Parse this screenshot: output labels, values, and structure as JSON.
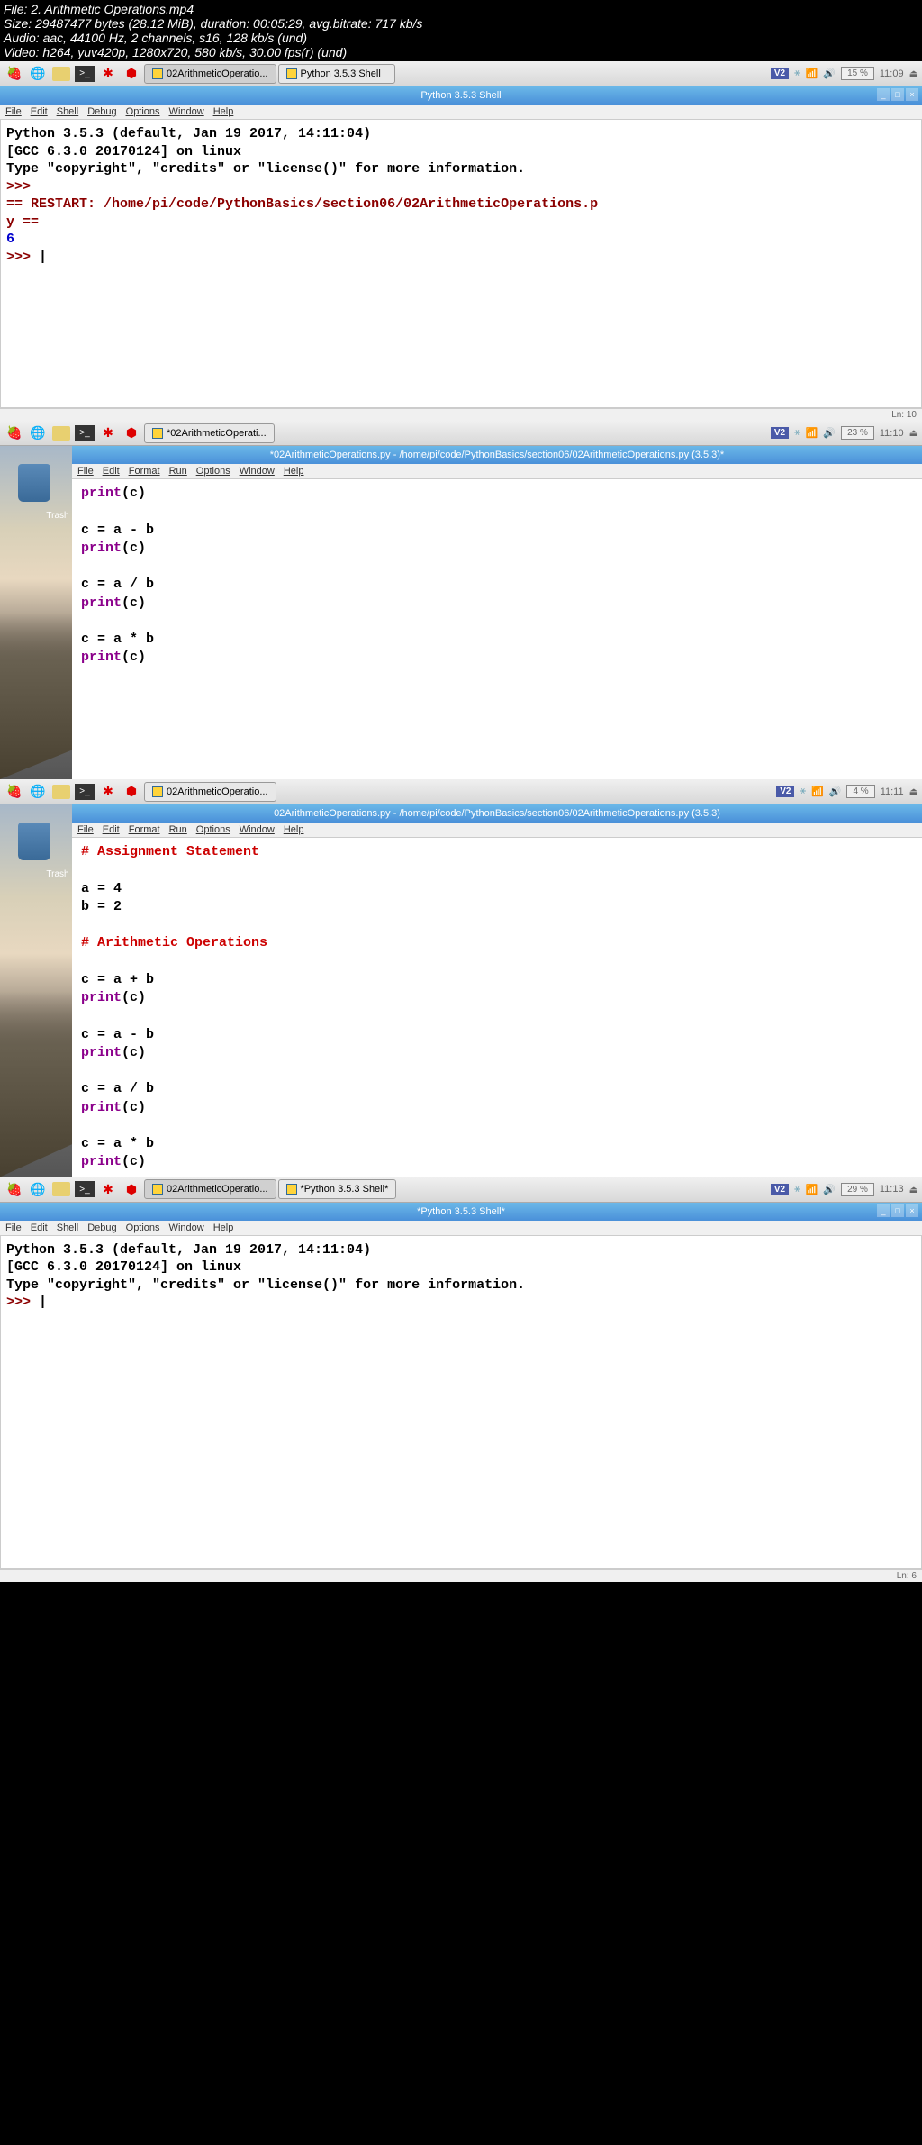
{
  "header": {
    "file": "File: 2. Arithmetic Operations.mp4",
    "size": "Size: 29487477 bytes (28.12 MiB), duration: 00:05:29, avg.bitrate: 717 kb/s",
    "audio": "Audio: aac, 44100 Hz, 2 channels, s16, 128 kb/s (und)",
    "video": "Video: h264, yuv420p, 1280x720, 580 kb/s, 30.00 fps(r) (und)"
  },
  "s1": {
    "taskbar": {
      "entry1": "02ArithmeticOperatio...",
      "entry2": "Python 3.5.3 Shell",
      "battery": "15 %",
      "time": "11:09"
    },
    "title": "Python 3.5.3 Shell",
    "menu": [
      "File",
      "Edit",
      "Shell",
      "Debug",
      "Options",
      "Window",
      "Help"
    ],
    "shell": {
      "line1": "Python 3.5.3 (default, Jan 19 2017, 14:11:04)",
      "line2": "[GCC 6.3.0 20170124] on linux",
      "line3": "Type \"copyright\", \"credits\" or \"license()\" for more information.",
      "prompt1": ">>>",
      "restart1": "== RESTART: /home/pi/code/PythonBasics/section06/02ArithmeticOperations.p",
      "restart2": "y ==",
      "out1": "6",
      "prompt2": ">>> "
    },
    "footer": "Ln: 10"
  },
  "s2": {
    "taskbar": {
      "entry1": "*02ArithmeticOperati...",
      "battery": "23 %",
      "time": "11:10"
    },
    "title": "*02ArithmeticOperations.py - /home/pi/code/PythonBasics/section06/02ArithmeticOperations.py (3.5.3)*",
    "menu": [
      "File",
      "Edit",
      "Format",
      "Run",
      "Options",
      "Window",
      "Help"
    ],
    "trash": "Trash",
    "code": {
      "l1": "print",
      "l1b": "(c)",
      "l2": "c = a - b",
      "l3": "print",
      "l3b": "(c)",
      "l4": "c = a / b",
      "l5": "print",
      "l5b": "(c)",
      "l6": "c = a * b",
      "l7": "print",
      "l7b": "(c)"
    }
  },
  "s3": {
    "taskbar": {
      "entry1": "02ArithmeticOperatio...",
      "battery": "4 %",
      "time": "11:11"
    },
    "title": "02ArithmeticOperations.py - /home/pi/code/PythonBasics/section06/02ArithmeticOperations.py (3.5.3)",
    "menu": [
      "File",
      "Edit",
      "Format",
      "Run",
      "Options",
      "Window",
      "Help"
    ],
    "trash": "Trash",
    "code": {
      "c1": "# Assignment Statement",
      "l1": "a = 4",
      "l2": "b = 2",
      "c2": "# Arithmetic Operations",
      "l3": "c = a + b",
      "p1": "print",
      "p1b": "(c)",
      "l4": "c = a - b",
      "p2": "print",
      "p2b": "(c)",
      "l5": "c = a / b",
      "p3": "print",
      "p3b": "(c)",
      "l6": "c = a * b",
      "p4": "print",
      "p4b": "(c)"
    }
  },
  "s4": {
    "taskbar": {
      "entry1": "02ArithmeticOperatio...",
      "entry2": "*Python 3.5.3 Shell*",
      "battery": "29 %",
      "time": "11:13"
    },
    "title": "*Python 3.5.3 Shell*",
    "menu": [
      "File",
      "Edit",
      "Shell",
      "Debug",
      "Options",
      "Window",
      "Help"
    ],
    "shell": {
      "line1": "Python 3.5.3 (default, Jan 19 2017, 14:11:04)",
      "line2": "[GCC 6.3.0 20170124] on linux",
      "line3": "Type \"copyright\", \"credits\" or \"license()\" for more information.",
      "prompt1": ">>> "
    },
    "footer": "Ln: 6"
  }
}
